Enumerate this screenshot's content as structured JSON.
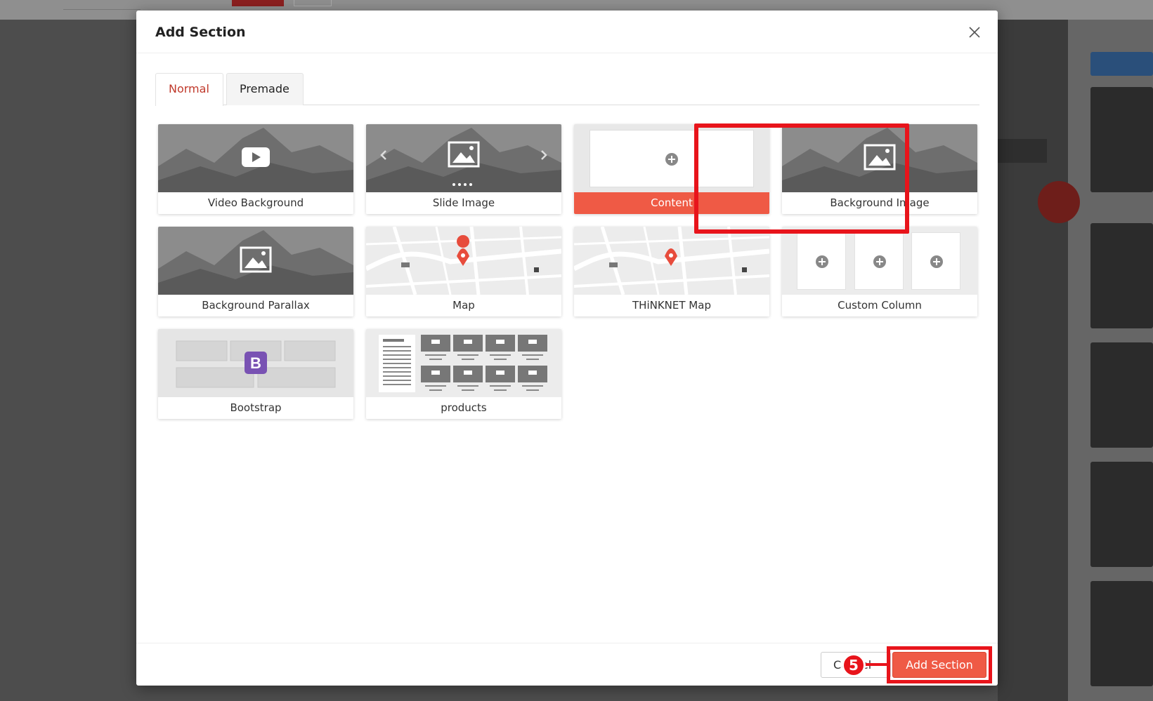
{
  "modal": {
    "title": "Add Section"
  },
  "tabs": [
    {
      "label": "Normal",
      "active": true
    },
    {
      "label": "Premade",
      "active": false
    }
  ],
  "sections": [
    {
      "label": "Video Background",
      "thumb": "mountain-play-icon"
    },
    {
      "label": "Slide Image",
      "thumb": "mountain-image-slider-icon"
    },
    {
      "label": "Content",
      "thumb": "plus-circle-icon",
      "selected": true
    },
    {
      "label": "Background Image",
      "thumb": "mountain-image-icon"
    },
    {
      "label": "Background Parallax",
      "thumb": "mountain-image-icon"
    },
    {
      "label": "Map",
      "thumb": "map-pin-icon"
    },
    {
      "label": "THiNKNET Map",
      "thumb": "map-pin-icon"
    },
    {
      "label": "Custom Column",
      "thumb": "three-plus-circles-icon"
    },
    {
      "label": "Bootstrap",
      "thumb": "bootstrap-logo-icon"
    },
    {
      "label": "products",
      "thumb": "product-grid-icon"
    }
  ],
  "footer": {
    "cancel_label": "Cancel",
    "add_label": "Add Section",
    "step_number": "5"
  },
  "colors": {
    "accent": "#ef5a45",
    "highlight": "#e8141b",
    "active_tab_text": "#c0392b"
  }
}
